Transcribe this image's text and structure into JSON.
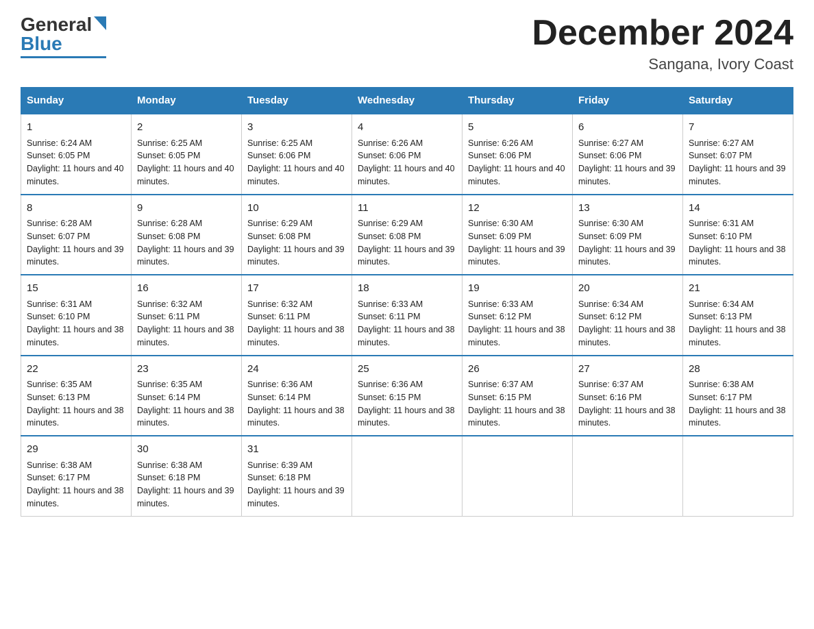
{
  "header": {
    "logo": {
      "part1": "General",
      "part2": "Blue"
    },
    "title": "December 2024",
    "subtitle": "Sangana, Ivory Coast"
  },
  "days": [
    "Sunday",
    "Monday",
    "Tuesday",
    "Wednesday",
    "Thursday",
    "Friday",
    "Saturday"
  ],
  "weeks": [
    [
      {
        "num": "1",
        "sunrise": "6:24 AM",
        "sunset": "6:05 PM",
        "daylight": "11 hours and 40 minutes."
      },
      {
        "num": "2",
        "sunrise": "6:25 AM",
        "sunset": "6:05 PM",
        "daylight": "11 hours and 40 minutes."
      },
      {
        "num": "3",
        "sunrise": "6:25 AM",
        "sunset": "6:06 PM",
        "daylight": "11 hours and 40 minutes."
      },
      {
        "num": "4",
        "sunrise": "6:26 AM",
        "sunset": "6:06 PM",
        "daylight": "11 hours and 40 minutes."
      },
      {
        "num": "5",
        "sunrise": "6:26 AM",
        "sunset": "6:06 PM",
        "daylight": "11 hours and 40 minutes."
      },
      {
        "num": "6",
        "sunrise": "6:27 AM",
        "sunset": "6:06 PM",
        "daylight": "11 hours and 39 minutes."
      },
      {
        "num": "7",
        "sunrise": "6:27 AM",
        "sunset": "6:07 PM",
        "daylight": "11 hours and 39 minutes."
      }
    ],
    [
      {
        "num": "8",
        "sunrise": "6:28 AM",
        "sunset": "6:07 PM",
        "daylight": "11 hours and 39 minutes."
      },
      {
        "num": "9",
        "sunrise": "6:28 AM",
        "sunset": "6:08 PM",
        "daylight": "11 hours and 39 minutes."
      },
      {
        "num": "10",
        "sunrise": "6:29 AM",
        "sunset": "6:08 PM",
        "daylight": "11 hours and 39 minutes."
      },
      {
        "num": "11",
        "sunrise": "6:29 AM",
        "sunset": "6:08 PM",
        "daylight": "11 hours and 39 minutes."
      },
      {
        "num": "12",
        "sunrise": "6:30 AM",
        "sunset": "6:09 PM",
        "daylight": "11 hours and 39 minutes."
      },
      {
        "num": "13",
        "sunrise": "6:30 AM",
        "sunset": "6:09 PM",
        "daylight": "11 hours and 39 minutes."
      },
      {
        "num": "14",
        "sunrise": "6:31 AM",
        "sunset": "6:10 PM",
        "daylight": "11 hours and 38 minutes."
      }
    ],
    [
      {
        "num": "15",
        "sunrise": "6:31 AM",
        "sunset": "6:10 PM",
        "daylight": "11 hours and 38 minutes."
      },
      {
        "num": "16",
        "sunrise": "6:32 AM",
        "sunset": "6:11 PM",
        "daylight": "11 hours and 38 minutes."
      },
      {
        "num": "17",
        "sunrise": "6:32 AM",
        "sunset": "6:11 PM",
        "daylight": "11 hours and 38 minutes."
      },
      {
        "num": "18",
        "sunrise": "6:33 AM",
        "sunset": "6:11 PM",
        "daylight": "11 hours and 38 minutes."
      },
      {
        "num": "19",
        "sunrise": "6:33 AM",
        "sunset": "6:12 PM",
        "daylight": "11 hours and 38 minutes."
      },
      {
        "num": "20",
        "sunrise": "6:34 AM",
        "sunset": "6:12 PM",
        "daylight": "11 hours and 38 minutes."
      },
      {
        "num": "21",
        "sunrise": "6:34 AM",
        "sunset": "6:13 PM",
        "daylight": "11 hours and 38 minutes."
      }
    ],
    [
      {
        "num": "22",
        "sunrise": "6:35 AM",
        "sunset": "6:13 PM",
        "daylight": "11 hours and 38 minutes."
      },
      {
        "num": "23",
        "sunrise": "6:35 AM",
        "sunset": "6:14 PM",
        "daylight": "11 hours and 38 minutes."
      },
      {
        "num": "24",
        "sunrise": "6:36 AM",
        "sunset": "6:14 PM",
        "daylight": "11 hours and 38 minutes."
      },
      {
        "num": "25",
        "sunrise": "6:36 AM",
        "sunset": "6:15 PM",
        "daylight": "11 hours and 38 minutes."
      },
      {
        "num": "26",
        "sunrise": "6:37 AM",
        "sunset": "6:15 PM",
        "daylight": "11 hours and 38 minutes."
      },
      {
        "num": "27",
        "sunrise": "6:37 AM",
        "sunset": "6:16 PM",
        "daylight": "11 hours and 38 minutes."
      },
      {
        "num": "28",
        "sunrise": "6:38 AM",
        "sunset": "6:17 PM",
        "daylight": "11 hours and 38 minutes."
      }
    ],
    [
      {
        "num": "29",
        "sunrise": "6:38 AM",
        "sunset": "6:17 PM",
        "daylight": "11 hours and 38 minutes."
      },
      {
        "num": "30",
        "sunrise": "6:38 AM",
        "sunset": "6:18 PM",
        "daylight": "11 hours and 39 minutes."
      },
      {
        "num": "31",
        "sunrise": "6:39 AM",
        "sunset": "6:18 PM",
        "daylight": "11 hours and 39 minutes."
      },
      null,
      null,
      null,
      null
    ]
  ],
  "labels": {
    "sunrise": "Sunrise:",
    "sunset": "Sunset:",
    "daylight": "Daylight:"
  }
}
